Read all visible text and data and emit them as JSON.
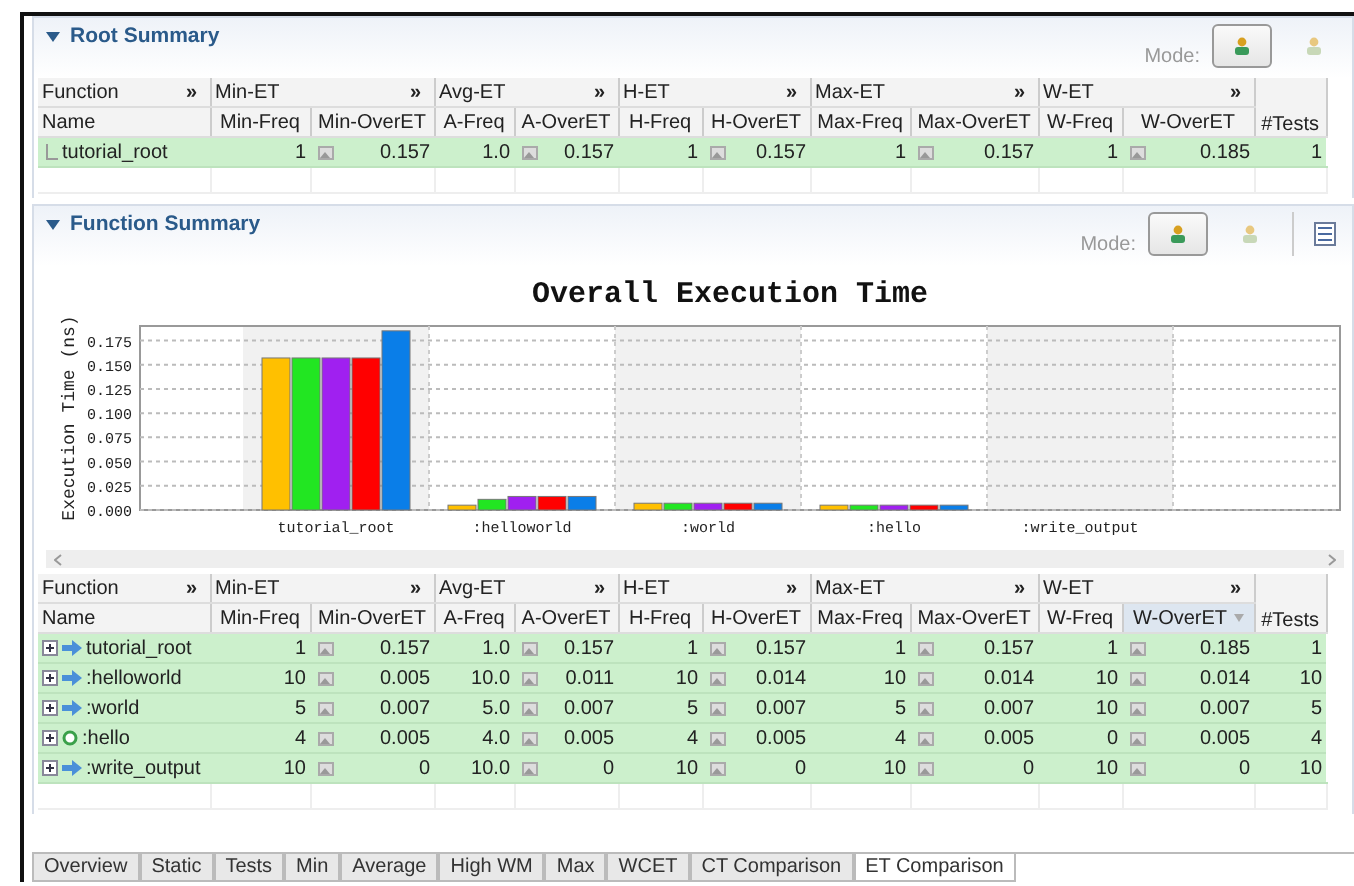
{
  "root_summary": {
    "title": "Root Summary",
    "mode_label": "Mode:",
    "modes": [
      {
        "selected": true
      },
      {
        "selected": false
      }
    ],
    "groups": [
      {
        "label": "Function",
        "more": "»"
      },
      {
        "label": "Min-ET",
        "more": "»"
      },
      {
        "label": "Avg-ET",
        "more": "»"
      },
      {
        "label": "H-ET",
        "more": "»"
      },
      {
        "label": "Max-ET",
        "more": "»"
      },
      {
        "label": "W-ET",
        "more": "»"
      }
    ],
    "columns": [
      "Name",
      "Min-Freq",
      "Min-OverET",
      "A-Freq",
      "A-OverET",
      "H-Freq",
      "H-OverET",
      "Max-Freq",
      "Max-OverET",
      "W-Freq",
      "W-OverET",
      "#Tests"
    ],
    "rows": [
      {
        "kind": "root",
        "cells": [
          "tutorial_root",
          "1",
          "0.157",
          "1.0",
          "0.157",
          "1",
          "0.157",
          "1",
          "0.157",
          "1",
          "0.185",
          "1"
        ]
      }
    ]
  },
  "function_summary": {
    "title": "Function Summary",
    "mode_label": "Mode:",
    "modes": [
      {
        "selected": true
      },
      {
        "selected": false
      }
    ],
    "chart_data": {
      "type": "bar",
      "title": "Overall Execution Time",
      "ylabel": "Execution Time (ns)",
      "grid": true,
      "categories": [
        "tutorial_root",
        ":helloworld",
        ":world",
        ":hello",
        ":write_output"
      ],
      "ylim": [
        0,
        0.19
      ],
      "yticks": [
        {
          "value": 0,
          "label": "0.000"
        },
        {
          "value": 0.025,
          "label": "0.025"
        },
        {
          "value": 0.05,
          "label": "0.050"
        },
        {
          "value": 0.075,
          "label": "0.075"
        },
        {
          "value": 0.1,
          "label": "0.100"
        },
        {
          "value": 0.125,
          "label": "0.125"
        },
        {
          "value": 0.15,
          "label": "0.150"
        },
        {
          "value": 0.175,
          "label": "0.175"
        }
      ],
      "series": [
        {
          "color": "#ffc000",
          "values": [
            0.157,
            0.005,
            0.007,
            0.005,
            0
          ]
        },
        {
          "color": "#22e622",
          "values": [
            0.157,
            0.011,
            0.007,
            0.005,
            0
          ]
        },
        {
          "color": "#a020f0",
          "values": [
            0.157,
            0.014,
            0.007,
            0.005,
            0
          ]
        },
        {
          "color": "#ff0000",
          "values": [
            0.157,
            0.014,
            0.007,
            0.005,
            0
          ]
        },
        {
          "color": "#0a7ee8",
          "values": [
            0.185,
            0.014,
            0.007,
            0.005,
            0
          ]
        }
      ]
    },
    "groups": [
      {
        "label": "Function",
        "more": "»"
      },
      {
        "label": "Min-ET",
        "more": "»"
      },
      {
        "label": "Avg-ET",
        "more": "»"
      },
      {
        "label": "H-ET",
        "more": "»"
      },
      {
        "label": "Max-ET",
        "more": "»"
      },
      {
        "label": "W-ET",
        "more": "»"
      }
    ],
    "columns": [
      {
        "label": "Name",
        "sorted": false
      },
      {
        "label": "Min-Freq",
        "sorted": false
      },
      {
        "label": "Min-OverET",
        "sorted": false
      },
      {
        "label": "A-Freq",
        "sorted": false
      },
      {
        "label": "A-OverET",
        "sorted": false
      },
      {
        "label": "H-Freq",
        "sorted": false
      },
      {
        "label": "H-OverET",
        "sorted": false
      },
      {
        "label": "Max-Freq",
        "sorted": false
      },
      {
        "label": "Max-OverET",
        "sorted": false
      },
      {
        "label": "W-Freq",
        "sorted": false
      },
      {
        "label": "W-OverET",
        "sorted": true
      },
      {
        "label": "#Tests",
        "sorted": false
      }
    ],
    "rows": [
      {
        "kind": "call",
        "cells": [
          "tutorial_root",
          "1",
          "0.157",
          "1.0",
          "0.157",
          "1",
          "0.157",
          "1",
          "0.157",
          "1",
          "0.185",
          "1"
        ]
      },
      {
        "kind": "call",
        "cells": [
          ":helloworld",
          "10",
          "0.005",
          "10.0",
          "0.011",
          "10",
          "0.014",
          "10",
          "0.014",
          "10",
          "0.014",
          "10"
        ]
      },
      {
        "kind": "call",
        "cells": [
          ":world",
          "5",
          "0.007",
          "5.0",
          "0.007",
          "5",
          "0.007",
          "5",
          "0.007",
          "10",
          "0.007",
          "5"
        ]
      },
      {
        "kind": "leaf",
        "cells": [
          ":hello",
          "4",
          "0.005",
          "4.0",
          "0.005",
          "4",
          "0.005",
          "4",
          "0.005",
          "0",
          "0.005",
          "4"
        ]
      },
      {
        "kind": "call",
        "cells": [
          ":write_output",
          "10",
          "0",
          "10.0",
          "0",
          "10",
          "0",
          "10",
          "0",
          "10",
          "0",
          "10"
        ]
      }
    ]
  },
  "tabs": [
    {
      "label": "Overview",
      "selected": false
    },
    {
      "label": "Static",
      "selected": false
    },
    {
      "label": "Tests",
      "selected": false
    },
    {
      "label": "Min",
      "selected": false
    },
    {
      "label": "Average",
      "selected": false
    },
    {
      "label": "High WM",
      "selected": false
    },
    {
      "label": "Max",
      "selected": false
    },
    {
      "label": "WCET",
      "selected": false
    },
    {
      "label": "CT Comparison",
      "selected": false
    },
    {
      "label": "ET Comparison",
      "selected": true
    }
  ]
}
